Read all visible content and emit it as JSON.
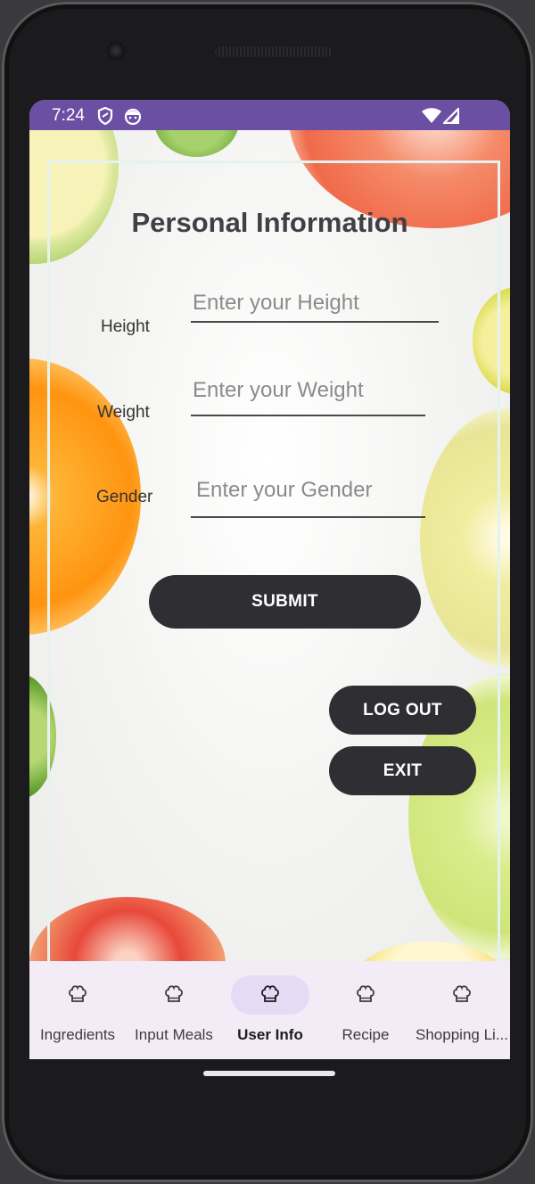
{
  "status_bar": {
    "time": "7:24",
    "icons": [
      "shield-icon",
      "face-icon",
      "wifi-icon",
      "signal-icon"
    ],
    "color": "#6b4fa3"
  },
  "page": {
    "title": "Personal Information"
  },
  "form": {
    "height": {
      "label": "Height",
      "placeholder": "Enter your Height"
    },
    "weight": {
      "label": "Weight",
      "placeholder": "Enter your Weight"
    },
    "gender": {
      "label": "Gender",
      "placeholder": "Enter your Gender"
    },
    "submit_label": "SUBMIT"
  },
  "actions": {
    "logout_label": "LOG OUT",
    "exit_label": "EXIT",
    "button_color": "#2f2f33"
  },
  "bottom_nav": {
    "items": [
      {
        "label": "Ingredients",
        "icon": "chef-hat-icon"
      },
      {
        "label": "Input Meals",
        "icon": "chef-hat-icon"
      },
      {
        "label": "User Info",
        "icon": "chef-hat-icon"
      },
      {
        "label": "Recipe",
        "icon": "chef-hat-icon"
      },
      {
        "label": "Shopping Li...",
        "icon": "chef-hat-icon"
      }
    ],
    "active": "User Info",
    "active_pill_color": "#e6dbf5"
  }
}
